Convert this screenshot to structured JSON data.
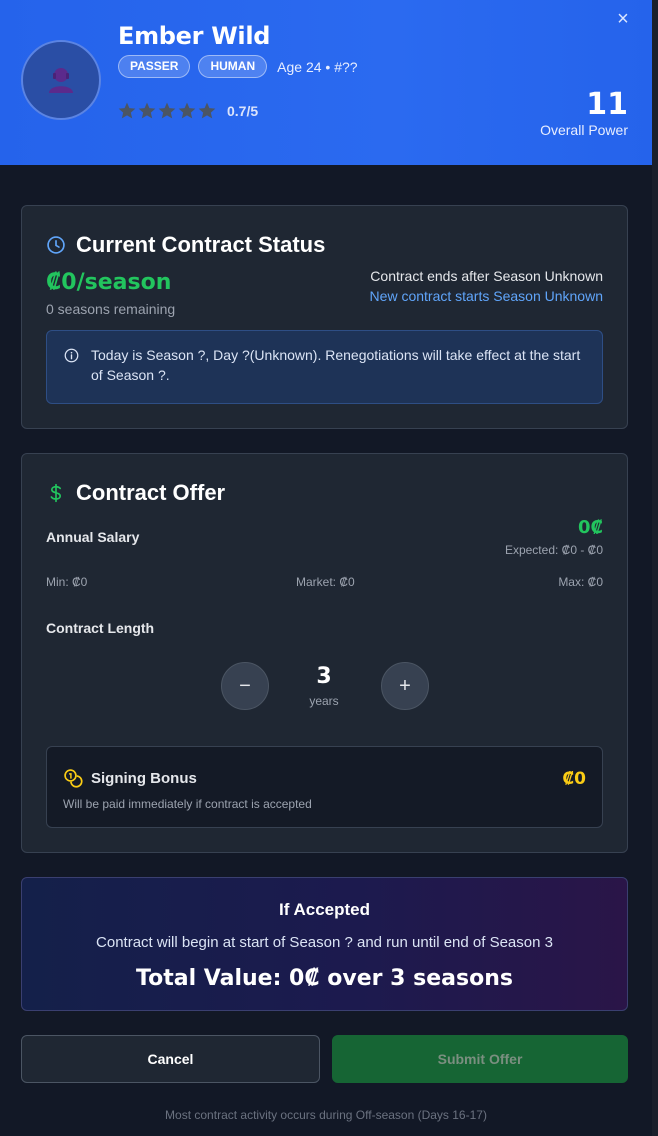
{
  "header": {
    "close_label": "×",
    "player_name": "Ember Wild",
    "position_tag": "PASSER",
    "race_tag": "HUMAN",
    "age_info": "Age 24 • #??",
    "rating_text": "0.7/5",
    "rating_value": 0.7,
    "rating_max": 5,
    "power_value": "11",
    "power_label": "Overall Power"
  },
  "status": {
    "title": "Current Contract Status",
    "salary": "₡0/season",
    "remaining": "0 seasons remaining",
    "ends": "Contract ends after Season Unknown",
    "new_start": "New contract starts Season Unknown",
    "notice": "Today is Season ?, Day ?(Unknown). Renegotiations will take effect at the start of Season ?."
  },
  "offer": {
    "title": "Contract Offer",
    "salary_label": "Annual Salary",
    "salary_value": "0₡",
    "expected": "Expected: ₡0 - ₡0",
    "min": "Min: ₡0",
    "market": "Market: ₡0",
    "max": "Max: ₡0",
    "length_label": "Contract Length",
    "decrement": "−",
    "increment": "+",
    "years_value": "3",
    "years_unit": "years",
    "bonus_title": "Signing Bonus",
    "bonus_value": "₡0",
    "bonus_desc": "Will be paid immediately if contract is accepted"
  },
  "accepted": {
    "title": "If Accepted",
    "description": "Contract will begin at start of Season ? and run until end of Season 3",
    "total": "Total Value: 0₡ over 3 seasons"
  },
  "actions": {
    "cancel": "Cancel",
    "submit": "Submit Offer"
  },
  "footer": "Most contract activity occurs during Off-season (Days 16-17)",
  "colors": {
    "header_bg": "#2563eb",
    "page_bg": "#121826",
    "card_bg": "#1f2733",
    "green": "#22c55e",
    "link_blue": "#60a5fa",
    "gold": "#facc15"
  },
  "icons": [
    "close-icon",
    "player-avatar-icon",
    "star-icon",
    "clock-icon",
    "info-icon",
    "dollar-icon",
    "coins-icon"
  ]
}
